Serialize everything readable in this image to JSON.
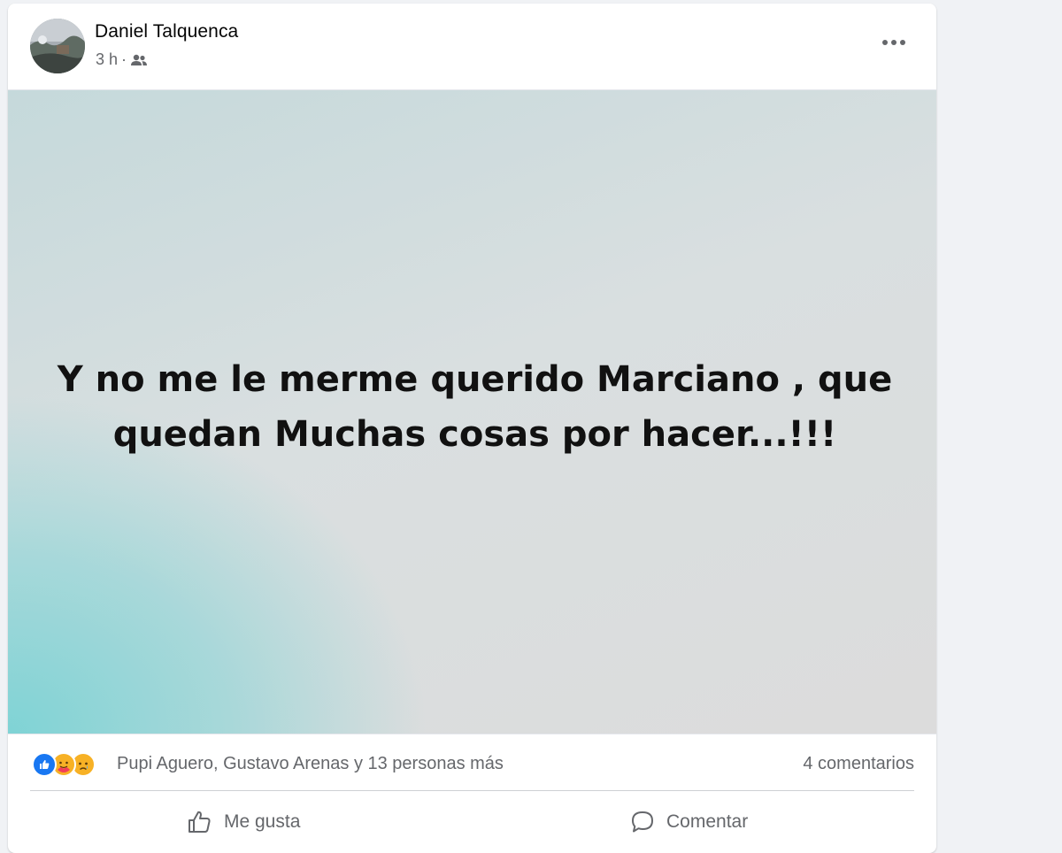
{
  "post": {
    "author": "Daniel Talquenca",
    "time": "3 h",
    "separator": "·",
    "audience_icon": "friends-icon",
    "more_icon": "ellipsis-icon",
    "text_line1": "Y no me le merme querido Marciano , que",
    "text_line2": "quedan Muchas cosas por hacer...!!!",
    "background_colors": {
      "accent_cyan": "#7fd3d5",
      "base_gray": "#dcdcdc"
    }
  },
  "reactions": {
    "icons": [
      "like-reaction-icon",
      "care-reaction-icon",
      "sad-reaction-icon"
    ],
    "reactors_text": "Pupi Aguero, Gustavo Arenas y 13 personas más",
    "comments_text": "4 comentarios"
  },
  "actions": {
    "like_label": "Me gusta",
    "comment_label": "Comentar"
  },
  "colors": {
    "brand_blue": "#1877f2",
    "secondary_text": "#65676b",
    "primary_text": "#050505"
  }
}
